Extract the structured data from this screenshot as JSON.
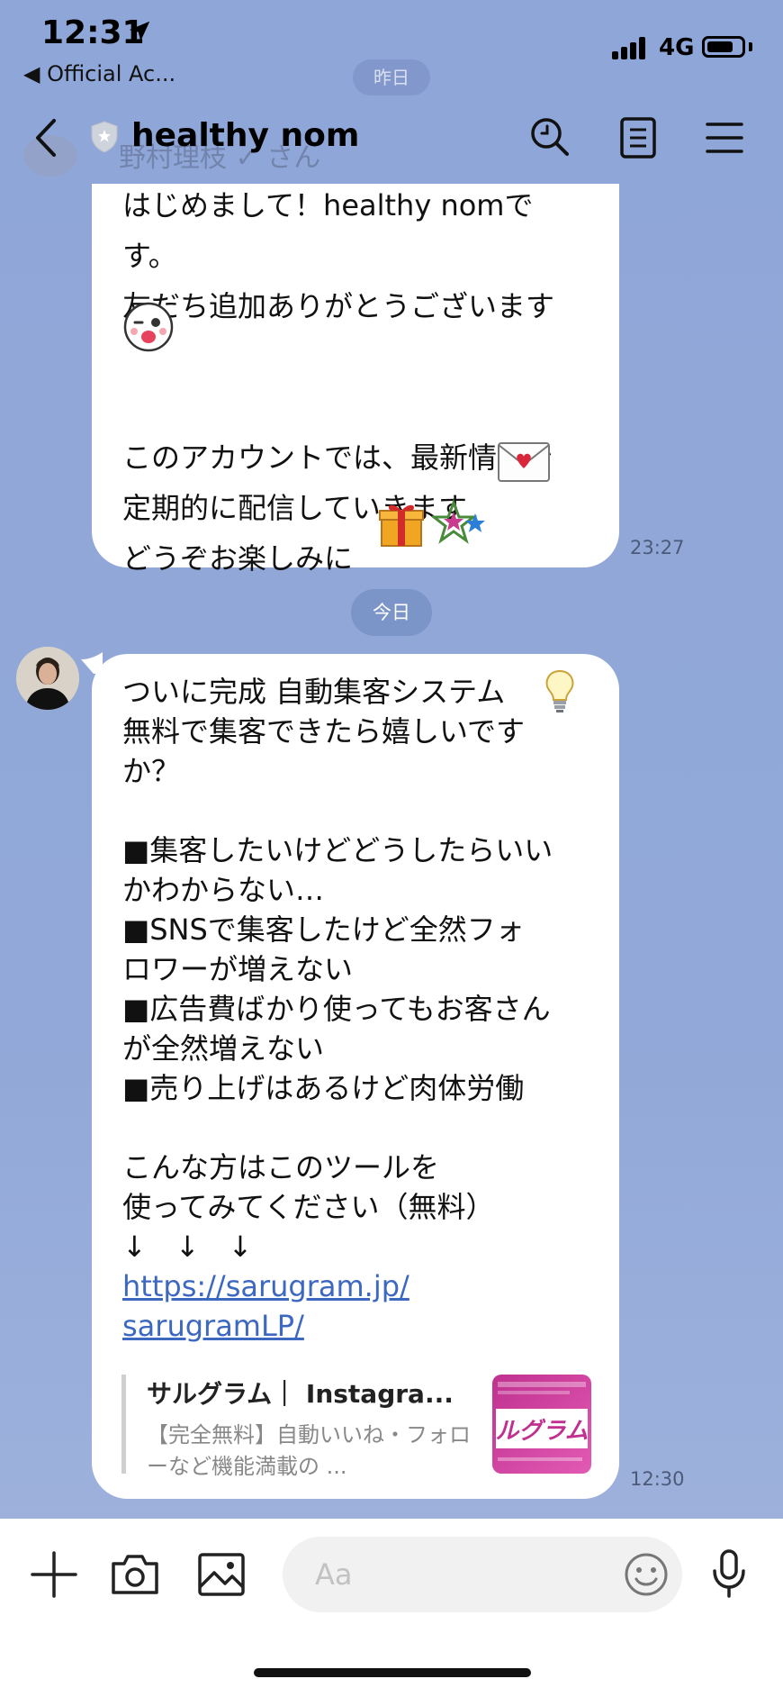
{
  "status_bar": {
    "time": "12:31",
    "back_label": "◀ Official Ac...",
    "network": "4G",
    "battery_level": 0.78
  },
  "header": {
    "title": "healthy nom",
    "ghost_date": "昨日",
    "ghost_name": "野村理枝 ✓ さん"
  },
  "messages": [
    {
      "text": "はじめまして！healthy nomで\nす。\n友だち追加ありがとうございます\n\n\nこのアカウントでは、最新情報を\n定期的に配信していきます\nどうぞお楽しみに",
      "time": "23:27"
    },
    {
      "text": "ついに完成 自動集客システム\n無料で集客できたら嬉しいです\nか？\n\n■集客したいけどどうしたらいい\nかわからない…\n■SNSで集客したけど全然フォ\nロワーが増えない\n■広告費ばかり使ってもお客さん\nが全然増えない\n■売り上げはあるけど肉体労働\n\nこんな方はこのツールを\n使ってみてください（無料）\n↓　↓　↓",
      "link_line1": "https://sarugram.jp/",
      "link_line2": "sarugramLP/",
      "time": "12:30"
    }
  ],
  "date_divider": "今日",
  "link_preview": {
    "title": "サルグラム｜ Instagra...",
    "description": "【完全無料】自動いいね・フォローなど機能満載の ...",
    "thumb_text": "ルグラム",
    "thumb_colors": [
      "#c0318f",
      "#e25ab4"
    ]
  },
  "input": {
    "placeholder": "Aa"
  },
  "icons": [
    "back-icon",
    "verified-shield-icon",
    "search-icon",
    "notes-icon",
    "menu-icon",
    "plus-icon",
    "camera-icon",
    "image-icon",
    "emoji-icon",
    "microphone-icon"
  ]
}
